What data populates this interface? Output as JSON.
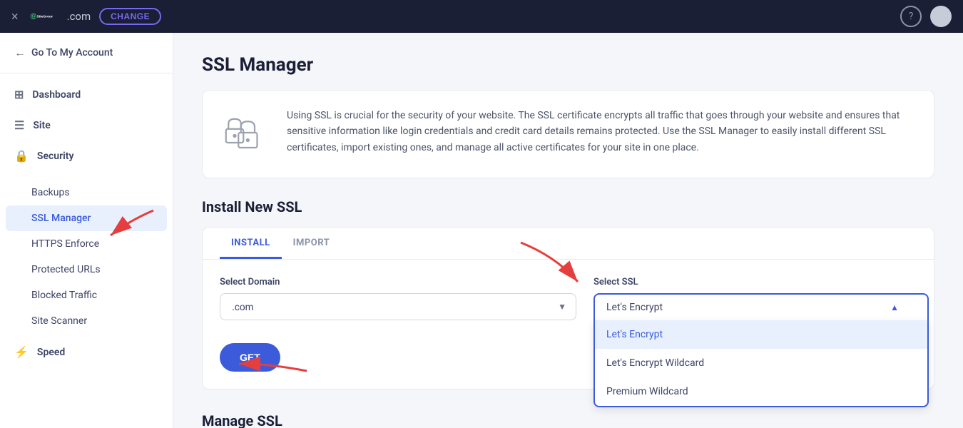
{
  "topnav": {
    "close_label": "×",
    "domain": ".com",
    "change_label": "CHANGE",
    "help_icon": "?",
    "logo_text": "SiteGround"
  },
  "sidebar": {
    "back_label": "Go To My Account",
    "items": [
      {
        "id": "dashboard",
        "label": "Dashboard",
        "icon": "⊞"
      },
      {
        "id": "site",
        "label": "Site",
        "icon": "☰"
      },
      {
        "id": "security",
        "label": "Security",
        "icon": "🔒"
      }
    ],
    "security_sub": [
      {
        "id": "backups",
        "label": "Backups",
        "active": false
      },
      {
        "id": "ssl-manager",
        "label": "SSL Manager",
        "active": true
      },
      {
        "id": "https-enforce",
        "label": "HTTPS Enforce",
        "active": false
      },
      {
        "id": "protected-urls",
        "label": "Protected URLs",
        "active": false
      },
      {
        "id": "blocked-traffic",
        "label": "Blocked Traffic",
        "active": false
      },
      {
        "id": "site-scanner",
        "label": "Site Scanner",
        "active": false
      }
    ],
    "speed_label": "Speed",
    "speed_icon": "⚡"
  },
  "main": {
    "page_title": "SSL Manager",
    "info_text": "Using SSL is crucial for the security of your website. The SSL certificate encrypts all traffic that goes through your website and ensures that sensitive information like login credentials and credit card details remains protected. Use the SSL Manager to easily install different SSL certificates, import existing ones, and manage all active certificates for your site in one place.",
    "install_section_title": "Install New SSL",
    "tabs": [
      {
        "id": "install",
        "label": "INSTALL",
        "active": true
      },
      {
        "id": "import",
        "label": "IMPORT",
        "active": false
      }
    ],
    "domain_label": "Select Domain",
    "domain_value": ".com",
    "ssl_label": "Select SSL",
    "ssl_selected": "Let's Encrypt",
    "ssl_options": [
      {
        "id": "lets-encrypt",
        "label": "Let's Encrypt",
        "selected": true
      },
      {
        "id": "lets-encrypt-wildcard",
        "label": "Let's Encrypt Wildcard",
        "selected": false
      },
      {
        "id": "premium-wildcard",
        "label": "Premium Wildcard",
        "selected": false
      }
    ],
    "get_button_label": "GET",
    "manage_title": "Manage SSL"
  }
}
